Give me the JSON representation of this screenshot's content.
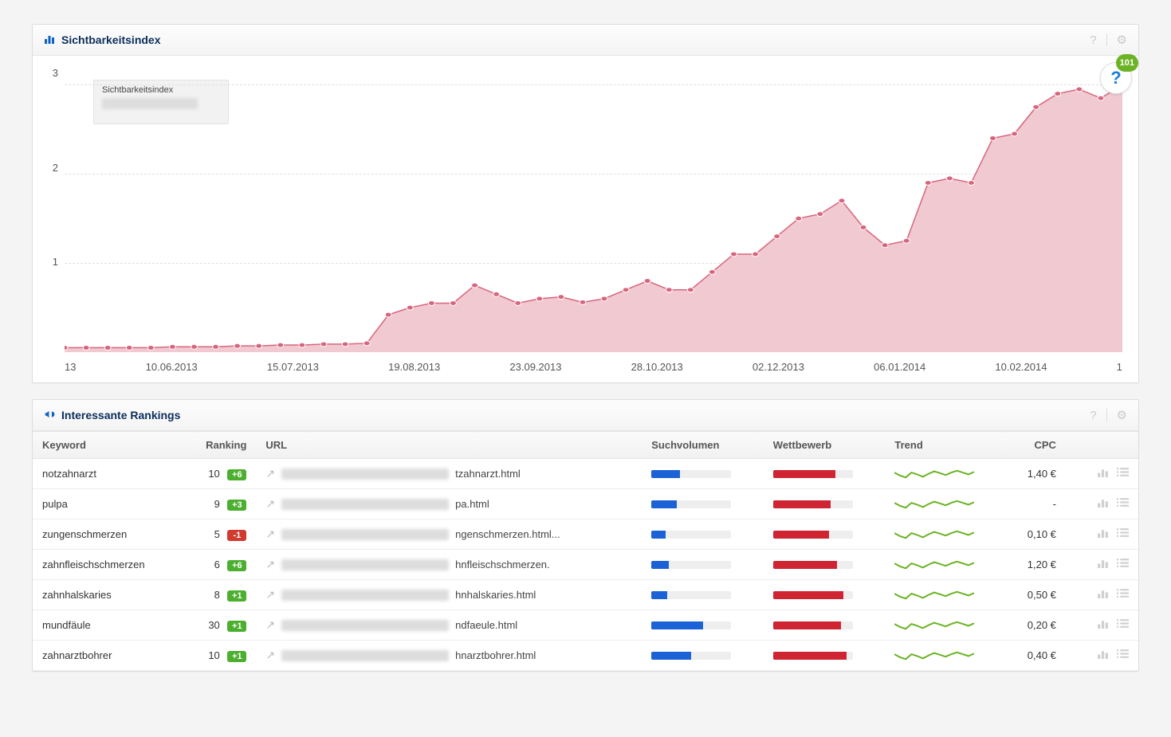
{
  "chart_panel": {
    "title": "Sichtbarkeitsindex",
    "legend_label": "Sichtbarkeitsindex",
    "help_count": "101"
  },
  "chart_data": {
    "type": "line",
    "title": "Sichtbarkeitsindex",
    "xlabel": "",
    "ylabel": "",
    "ylim": [
      0,
      3.2
    ],
    "x_ticks": [
      "13",
      "10.06.2013",
      "15.07.2013",
      "19.08.2013",
      "23.09.2013",
      "28.10.2013",
      "02.12.2013",
      "06.01.2014",
      "10.02.2014",
      "1"
    ],
    "y_ticks": [
      1,
      2,
      3
    ],
    "series": [
      {
        "name": "Sichtbarkeitsindex",
        "color": "#d7657c",
        "fill": "#f1c9d1",
        "values": [
          0.05,
          0.05,
          0.05,
          0.05,
          0.05,
          0.06,
          0.06,
          0.06,
          0.07,
          0.07,
          0.08,
          0.08,
          0.09,
          0.09,
          0.1,
          0.42,
          0.5,
          0.55,
          0.55,
          0.75,
          0.65,
          0.55,
          0.6,
          0.62,
          0.56,
          0.6,
          0.7,
          0.8,
          0.7,
          0.7,
          0.9,
          1.1,
          1.1,
          1.3,
          1.5,
          1.55,
          1.7,
          1.4,
          1.2,
          1.25,
          1.9,
          1.95,
          1.9,
          2.4,
          2.45,
          2.75,
          2.9,
          2.95,
          2.85,
          3.0
        ]
      }
    ]
  },
  "rankings_panel": {
    "title": "Interessante Rankings",
    "columns": {
      "keyword": "Keyword",
      "ranking": "Ranking",
      "url": "URL",
      "volume": "Suchvolumen",
      "competition": "Wettbewerb",
      "trend": "Trend",
      "cpc": "CPC"
    },
    "rows": [
      {
        "keyword": "notzahnarzt",
        "ranking": 10,
        "delta": "+6",
        "delta_dir": "up",
        "url_suffix": "tzahnarzt.html",
        "volume": 36,
        "competition": 78,
        "cpc": "1,40 €"
      },
      {
        "keyword": "pulpa",
        "ranking": 9,
        "delta": "+3",
        "delta_dir": "up",
        "url_suffix": "pa.html",
        "volume": 32,
        "competition": 72,
        "cpc": "-"
      },
      {
        "keyword": "zungenschmerzen",
        "ranking": 5,
        "delta": "-1",
        "delta_dir": "down",
        "url_suffix": "ngenschmerzen.html...",
        "volume": 18,
        "competition": 70,
        "cpc": "0,10 €"
      },
      {
        "keyword": "zahnfleischschmerzen",
        "ranking": 6,
        "delta": "+6",
        "delta_dir": "up",
        "url_suffix": "hnfleischschmerzen.",
        "volume": 22,
        "competition": 80,
        "cpc": "1,20 €"
      },
      {
        "keyword": "zahnhalskaries",
        "ranking": 8,
        "delta": "+1",
        "delta_dir": "up",
        "url_suffix": "hnhalskaries.html",
        "volume": 20,
        "competition": 88,
        "cpc": "0,50 €"
      },
      {
        "keyword": "mundfäule",
        "ranking": 30,
        "delta": "+1",
        "delta_dir": "up",
        "url_suffix": "ndfaeule.html",
        "volume": 65,
        "competition": 85,
        "cpc": "0,20 €"
      },
      {
        "keyword": "zahnarztbohrer",
        "ranking": 10,
        "delta": "+1",
        "delta_dir": "up",
        "url_suffix": "hnarztbohrer.html",
        "volume": 50,
        "competition": 92,
        "cpc": "0,40 €"
      }
    ]
  }
}
